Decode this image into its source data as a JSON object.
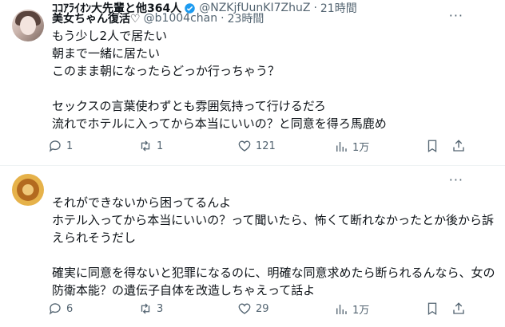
{
  "tweets": [
    {
      "display_name": "美女ちゃん復活♡",
      "handle": "@b1004chan",
      "separator": "·",
      "time": "23時間",
      "more": "···",
      "text": "もう少し2人で居たい\n朝まで一緒に居たい\nこのまま朝になったらどっか行っちゃう？\n\nセックスの言葉使わずとも雰囲気持って行けるだろ\n流れでホテルに入ってから本当にいいの？と同意を得ろ馬鹿め",
      "replies": "1",
      "retweets": "1",
      "likes": "121",
      "views": "1万",
      "verified": false
    },
    {
      "display_name": "ｺｺｱﾗｲｵﾝ大先輩と他364人",
      "handle": "@NZKjfUunKI7ZhuZ",
      "separator": "·",
      "time": "21時間",
      "more": "···",
      "text": "それができないから困ってるんよ\nホテル入ってから本当にいいの？って聞いたら、怖くて断れなかったとか後から訴えられそうだし\n\n確実に同意を得ないと犯罪になるのに、明確な同意求めたら断られるんなら、女の防衛本能？の遺伝子自体を改造しちゃえって話よ",
      "replies": "6",
      "retweets": "3",
      "likes": "29",
      "views": "1万",
      "verified": true
    }
  ],
  "colors": {
    "text": "#0f1419",
    "muted": "#536471",
    "verified": "#1d9bf0",
    "divider": "#eff3f4"
  },
  "icons": [
    "reply-icon",
    "retweet-icon",
    "like-icon",
    "views-icon",
    "bookmark-icon",
    "share-icon",
    "verified-badge-icon",
    "more-icon"
  ]
}
